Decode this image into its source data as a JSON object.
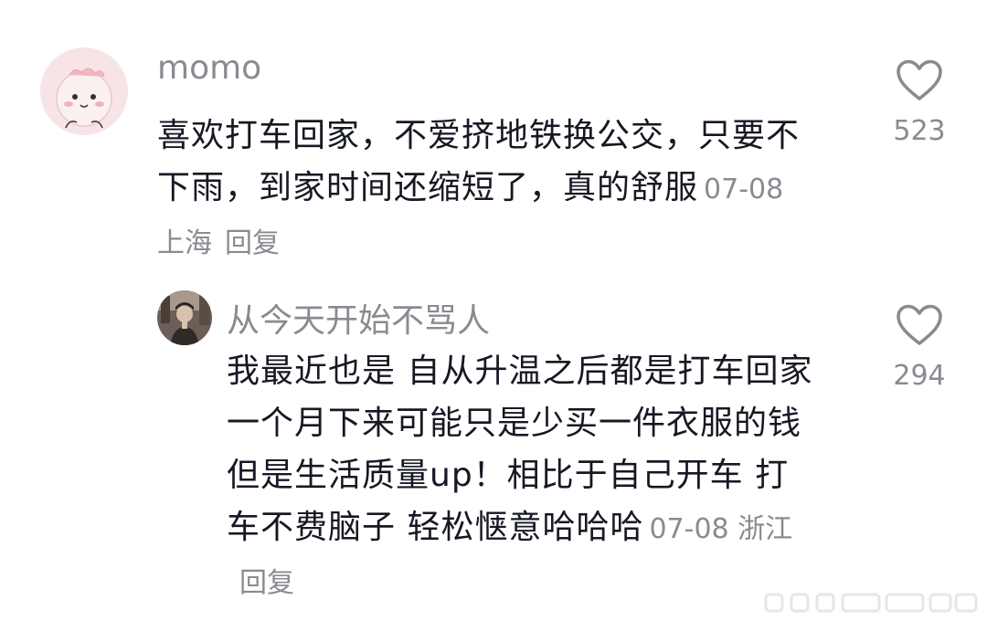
{
  "comments": [
    {
      "username": "momo",
      "text": "喜欢打车回家，不爱挤地铁换公交，只要不下雨，到家时间还缩短了，真的舒服",
      "date": "07-08",
      "location": "上海",
      "reply_label": "回复",
      "likes": "523",
      "avatar_icon": "cartoon-avatar",
      "like_icon": "heart-outline-icon"
    },
    {
      "username": "从今天开始不骂人",
      "text": "我最近也是 自从升温之后都是打车回家 一个月下来可能只是少买一件衣服的钱 但是生活质量up！相比于自己开车 打车不费脑子 轻松惬意哈哈哈",
      "date": "07-08",
      "location": "浙江",
      "reply_label": "回复",
      "likes": "294",
      "avatar_icon": "photo-avatar",
      "like_icon": "heart-outline-icon"
    }
  ],
  "colors": {
    "text_primary": "#161823",
    "text_secondary": "#8a8b91",
    "icon": "#8a8b91"
  }
}
